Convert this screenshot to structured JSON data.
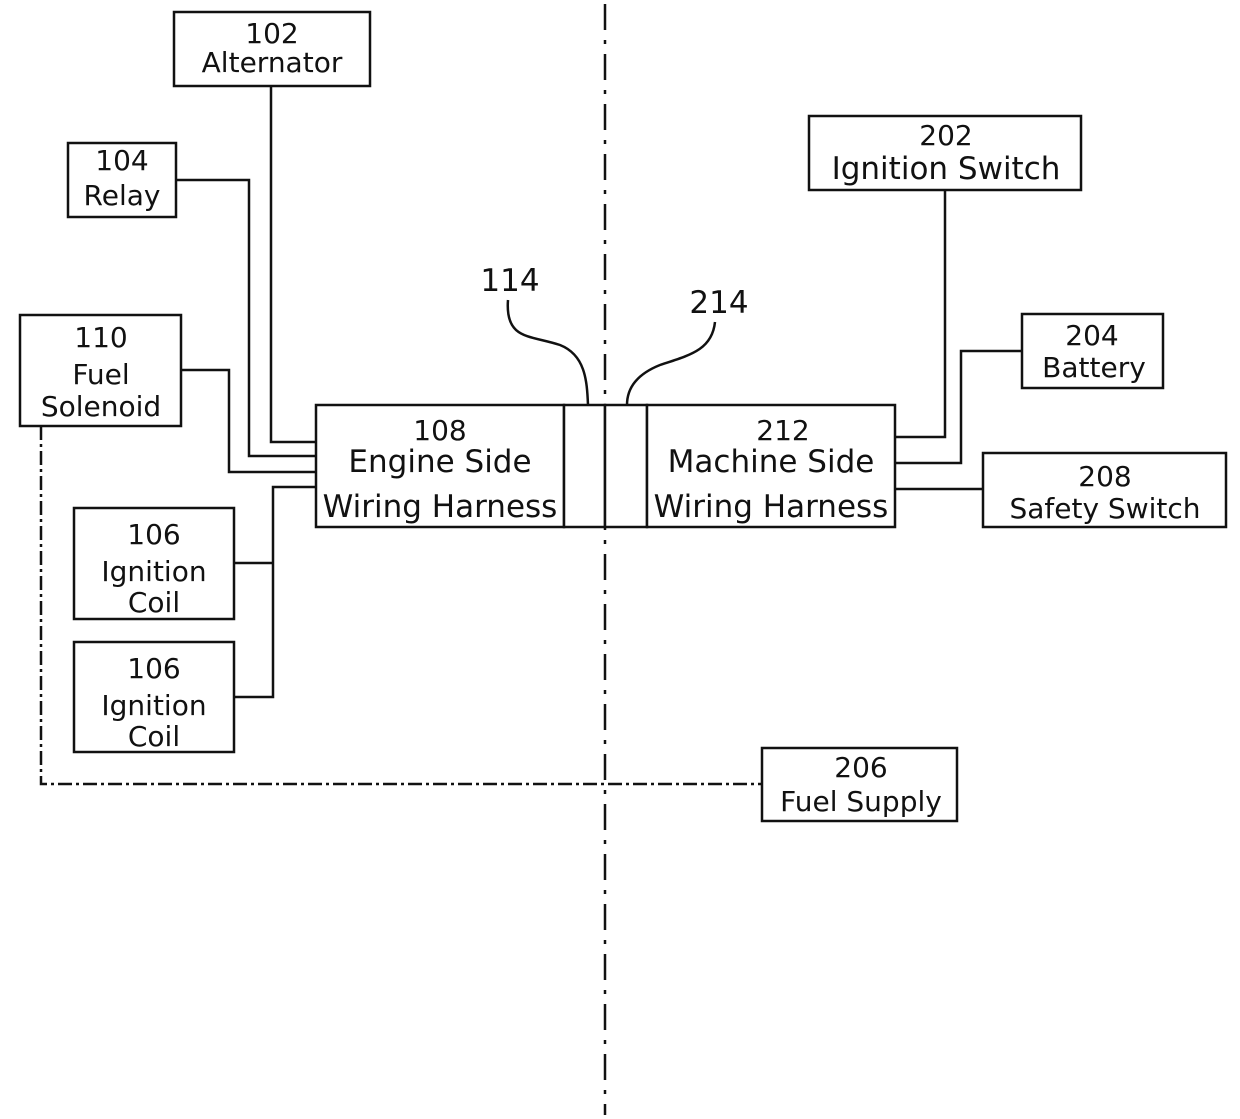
{
  "diagram": {
    "components": {
      "alternator": {
        "ref": "102",
        "name": "Alternator"
      },
      "relay": {
        "ref": "104",
        "name": "Relay"
      },
      "fuel_solenoid": {
        "ref": "110",
        "name_line1": "Fuel",
        "name_line2": "Solenoid"
      },
      "ignition_coil_1": {
        "ref": "106",
        "name_line1": "Ignition",
        "name_line2": "Coil"
      },
      "ignition_coil_2": {
        "ref": "106",
        "name_line1": "Ignition",
        "name_line2": "Coil"
      },
      "engine_harness": {
        "ref": "108",
        "name_line1": "Engine Side",
        "name_line2": "Wiring Harness"
      },
      "machine_harness": {
        "ref": "212",
        "name_line1": "Machine Side",
        "name_line2": "Wiring Harness"
      },
      "ignition_switch": {
        "ref": "202",
        "name": "Ignition Switch"
      },
      "battery": {
        "ref": "204",
        "name": "Battery"
      },
      "safety_switch": {
        "ref": "208",
        "name": "Safety Switch"
      },
      "fuel_supply": {
        "ref": "206",
        "name": "Fuel Supply"
      }
    },
    "callouts": {
      "engine_connector": "114",
      "machine_connector": "214"
    }
  }
}
